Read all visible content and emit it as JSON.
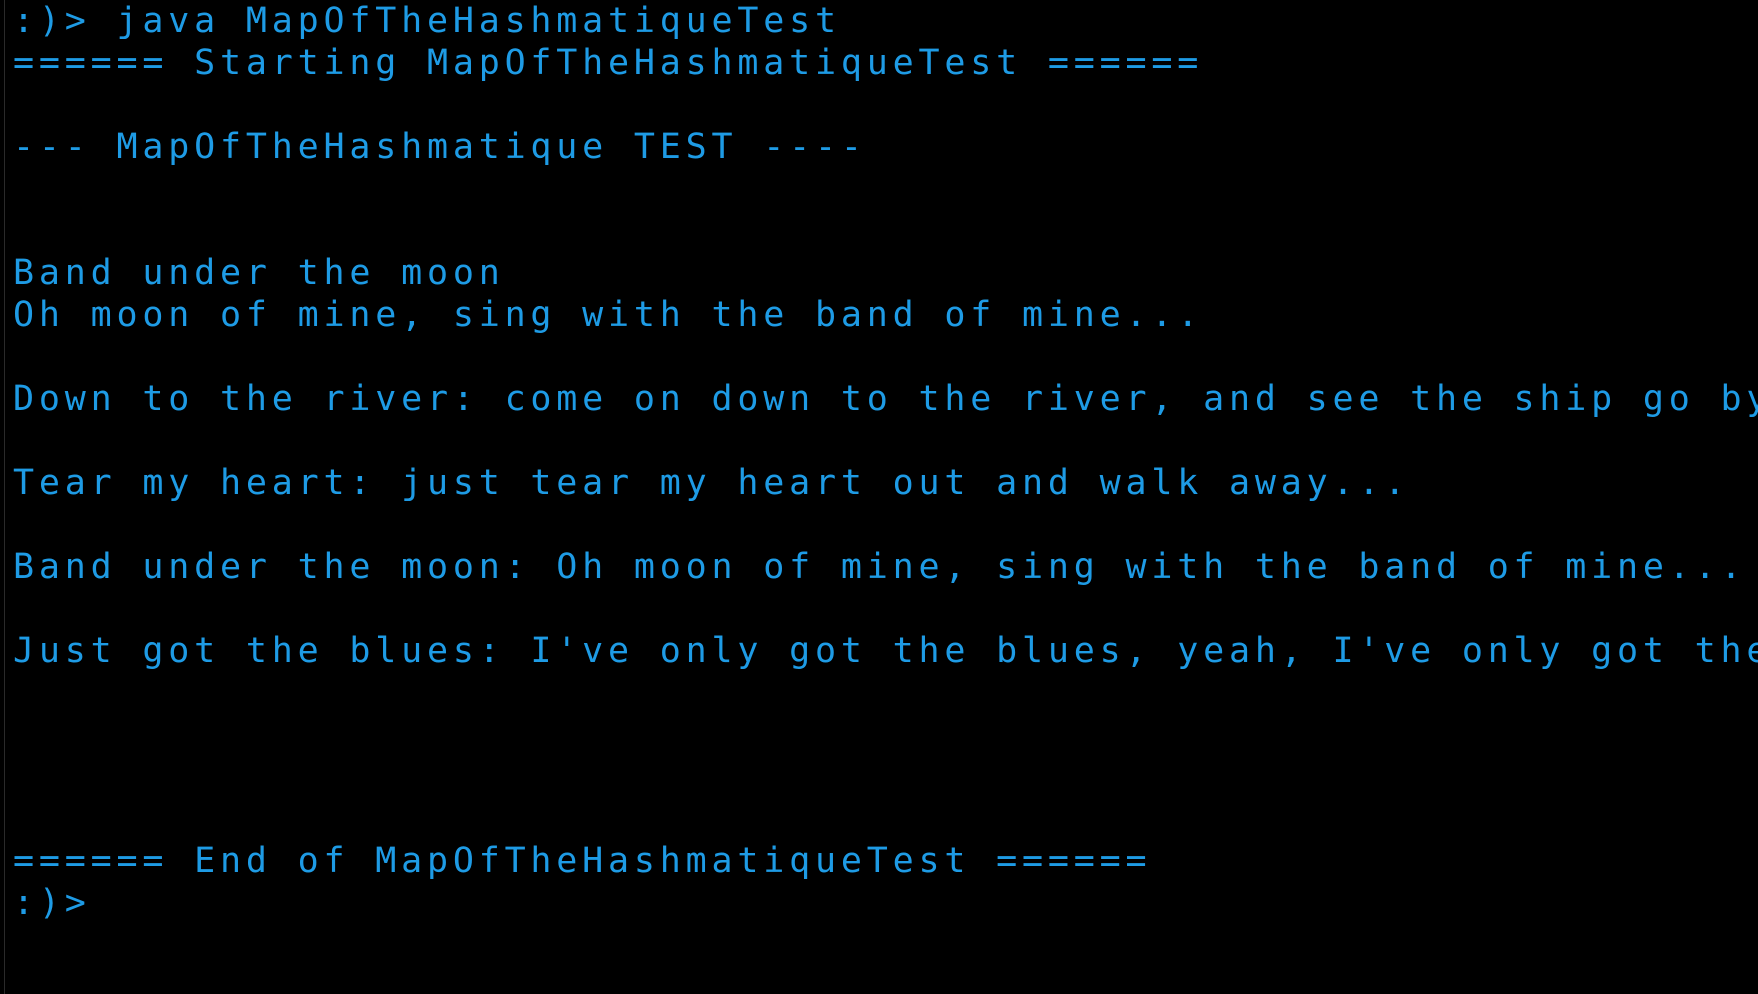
{
  "colors": {
    "background": "#000000",
    "text": "#1e9be5"
  },
  "lines": [
    ":)> java MapOfTheHashmatiqueTest",
    "====== Starting MapOfTheHashmatiqueTest ======",
    "",
    "--- MapOfTheHashmatique TEST ----",
    "",
    "",
    "Band under the moon",
    "Oh moon of mine, sing with the band of mine...",
    "",
    "Down to the river: come on down to the river, and see the ship go by...",
    "",
    "Tear my heart: just tear my heart out and walk away...",
    "",
    "Band under the moon: Oh moon of mine, sing with the band of mine...",
    "",
    "Just got the blues: I've only got the blues, yeah, I've only got the blues...",
    "",
    "",
    "",
    "",
    "====== End of MapOfTheHashmatiqueTest ======",
    ":)>"
  ]
}
